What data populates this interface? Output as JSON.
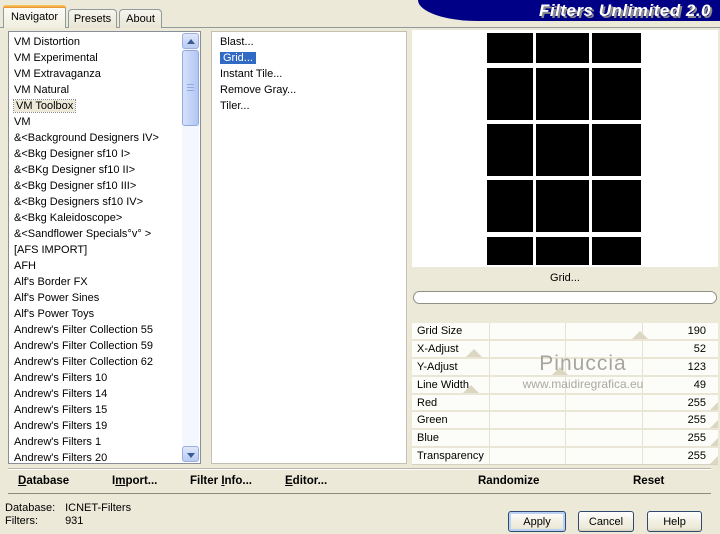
{
  "window": {
    "title": "Filters Unlimited 2.0"
  },
  "tabs": [
    {
      "label": "Navigator",
      "active": true
    },
    {
      "label": "Presets",
      "active": false
    },
    {
      "label": "About",
      "active": false
    }
  ],
  "category_list": {
    "items": [
      "VM Distortion",
      "VM Experimental",
      "VM Extravaganza",
      "VM Natural",
      "VM Toolbox",
      "VM",
      "&<Background Designers IV>",
      "&<Bkg Designer sf10 I>",
      "&<BKg Designer sf10 II>",
      "&<Bkg Designer sf10 III>",
      "&<Bkg Designers sf10 IV>",
      "&<Bkg Kaleidoscope>",
      "&<Sandflower Specials°v° >",
      "[AFS IMPORT]",
      "AFH",
      "Alf's Border FX",
      "Alf's Power Sines",
      "Alf's Power Toys",
      "Andrew's Filter Collection 55",
      "Andrew's Filter Collection 59",
      "Andrew's Filter Collection 62",
      "Andrew's Filters 10",
      "Andrew's Filters 14",
      "Andrew's Filters 15",
      "Andrew's Filters 19",
      "Andrew's Filters 1",
      "Andrew's Filters 20"
    ],
    "selected": "VM Toolbox"
  },
  "filter_list": {
    "items": [
      "Blast...",
      "Grid...",
      "Instant Tile...",
      "Remove Gray...",
      "Tiler..."
    ],
    "selected": "Grid..."
  },
  "preview": {
    "caption": "Grid...",
    "pattern": "black-grid-on-white",
    "grid_columns": 3,
    "grid_rows": 5
  },
  "sliders": {
    "max": 255,
    "rows": [
      {
        "label": "Grid Size",
        "value": 190
      },
      {
        "label": "X-Adjust",
        "value": 52
      },
      {
        "label": "Y-Adjust",
        "value": 123
      },
      {
        "label": "Line Width",
        "value": 49
      },
      {
        "label": "Red",
        "value": 255
      },
      {
        "label": "Green",
        "value": 255
      },
      {
        "label": "Blue",
        "value": 255
      },
      {
        "label": "Transparency",
        "value": 255
      }
    ]
  },
  "watermark": {
    "line1": "Pinuccia",
    "line2": "www.maidiregrafica.eu"
  },
  "action_bar": [
    {
      "pre": "",
      "u": "D",
      "post": "atabase"
    },
    {
      "pre": "I",
      "u": "m",
      "post": "port..."
    },
    {
      "pre": "Filter ",
      "u": "I",
      "post": "nfo..."
    },
    {
      "pre": "",
      "u": "E",
      "post": "ditor..."
    },
    {
      "pre": "Randomize",
      "u": "",
      "post": ""
    },
    {
      "pre": "Reset",
      "u": "",
      "post": ""
    }
  ],
  "status": {
    "rows": [
      {
        "label": "Database:",
        "value": "ICNET-Filters"
      },
      {
        "label": "Filters:",
        "value": "931"
      }
    ]
  },
  "dialog_buttons": [
    "Apply",
    "Cancel",
    "Help"
  ],
  "colors": {
    "background": "#ece9d8",
    "banner_navy": "#000086",
    "selection_blue": "#316ac5",
    "active_tab_orange": "#e5902e",
    "watermark_gray": "#93908a"
  }
}
